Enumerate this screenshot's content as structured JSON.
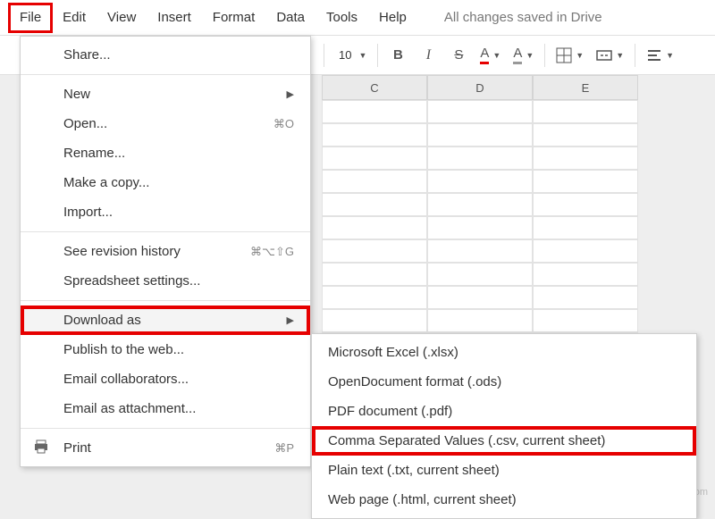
{
  "menubar": {
    "items": [
      "File",
      "Edit",
      "View",
      "Insert",
      "Format",
      "Data",
      "Tools",
      "Help"
    ],
    "status": "All changes saved in Drive"
  },
  "toolbar": {
    "font_size": "10",
    "bold": "B",
    "italic": "I",
    "strike": "S",
    "text_color": "A",
    "fill_color": "A"
  },
  "columns": [
    "C",
    "D",
    "E"
  ],
  "file_menu": {
    "share": "Share...",
    "new": "New",
    "open": "Open...",
    "open_sc": "⌘O",
    "rename": "Rename...",
    "make_copy": "Make a copy...",
    "import": "Import...",
    "revision": "See revision history",
    "revision_sc": "⌘⌥⇧G",
    "settings": "Spreadsheet settings...",
    "download": "Download as",
    "publish": "Publish to the web...",
    "email_collab": "Email collaborators...",
    "email_attach": "Email as attachment...",
    "print": "Print",
    "print_sc": "⌘P"
  },
  "download_submenu": {
    "xlsx": "Microsoft Excel (.xlsx)",
    "ods": "OpenDocument format (.ods)",
    "pdf": "PDF document (.pdf)",
    "csv": "Comma Separated Values (.csv, current sheet)",
    "txt": "Plain text (.txt, current sheet)",
    "html": "Web page (.html, current sheet)"
  },
  "watermark": "wsxdn.com"
}
